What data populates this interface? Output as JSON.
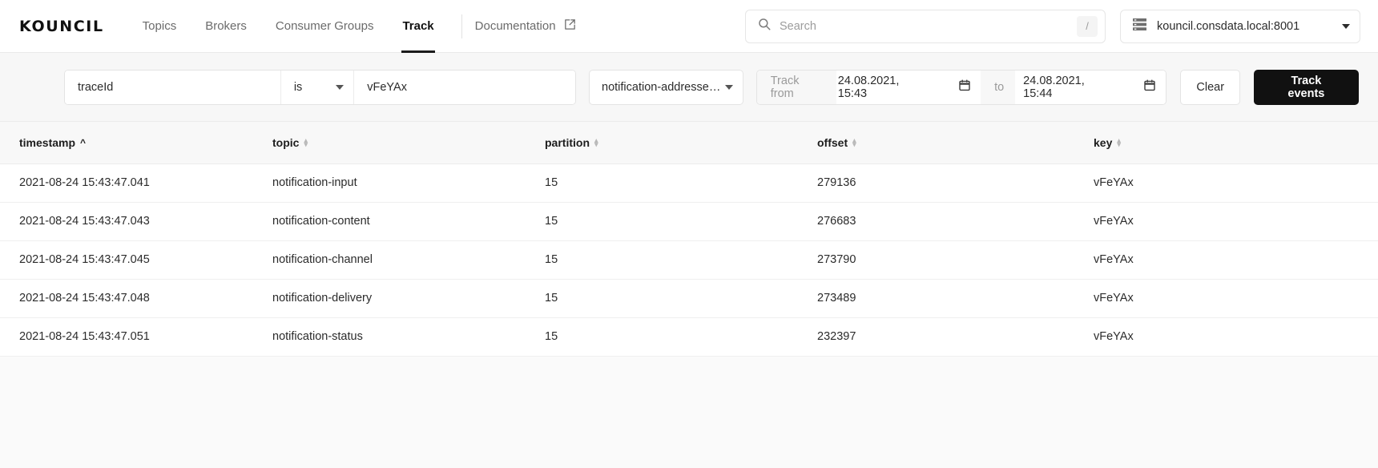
{
  "header": {
    "brand": "KOUNCIL",
    "nav": [
      {
        "label": "Topics",
        "active": false
      },
      {
        "label": "Brokers",
        "active": false
      },
      {
        "label": "Consumer Groups",
        "active": false
      },
      {
        "label": "Track",
        "active": true
      }
    ],
    "documentation_label": "Documentation",
    "documentation_icon": "external-link-icon",
    "search": {
      "placeholder": "Search",
      "value": "",
      "icon": "search-icon",
      "shortcut_key": "/"
    },
    "server": {
      "icon": "server-stack-icon",
      "name": "kouncil.consdata.local:8001",
      "caret_icon": "chevron-down-icon"
    }
  },
  "toolbar": {
    "filter_field_value": "traceId",
    "filter_operator_value": "is",
    "filter_value": "vFeYAx",
    "topic_select_value": "notification-addressee...",
    "track_from_label": "Track from",
    "track_from_value": "24.08.2021, 15:43",
    "track_to_label": "to",
    "track_to_value": "24.08.2021, 15:44",
    "calendar_icon": "calendar-icon",
    "clear_label": "Clear",
    "track_events_label": "Track events"
  },
  "table": {
    "columns": [
      {
        "label": "timestamp",
        "sort": "asc"
      },
      {
        "label": "topic",
        "sort": "none"
      },
      {
        "label": "partition",
        "sort": "none"
      },
      {
        "label": "offset",
        "sort": "none"
      },
      {
        "label": "key",
        "sort": "none"
      }
    ],
    "rows": [
      {
        "timestamp": "2021-08-24 15:43:47.041",
        "topic": "notification-input",
        "partition": "15",
        "offset": "279136",
        "key": "vFeYAx"
      },
      {
        "timestamp": "2021-08-24 15:43:47.043",
        "topic": "notification-content",
        "partition": "15",
        "offset": "276683",
        "key": "vFeYAx"
      },
      {
        "timestamp": "2021-08-24 15:43:47.045",
        "topic": "notification-channel",
        "partition": "15",
        "offset": "273790",
        "key": "vFeYAx"
      },
      {
        "timestamp": "2021-08-24 15:43:47.048",
        "topic": "notification-delivery",
        "partition": "15",
        "offset": "273489",
        "key": "vFeYAx"
      },
      {
        "timestamp": "2021-08-24 15:43:47.051",
        "topic": "notification-status",
        "partition": "15",
        "offset": "232397",
        "key": "vFeYAx"
      }
    ]
  },
  "colors": {
    "accent_dark": "#111111",
    "page_background": "#fafafa",
    "toolbar_background": "#f7f7f7",
    "table_header_background": "#f8f8f8",
    "text_primary": "#2b2b2b",
    "text_muted": "#9a9a9a"
  }
}
